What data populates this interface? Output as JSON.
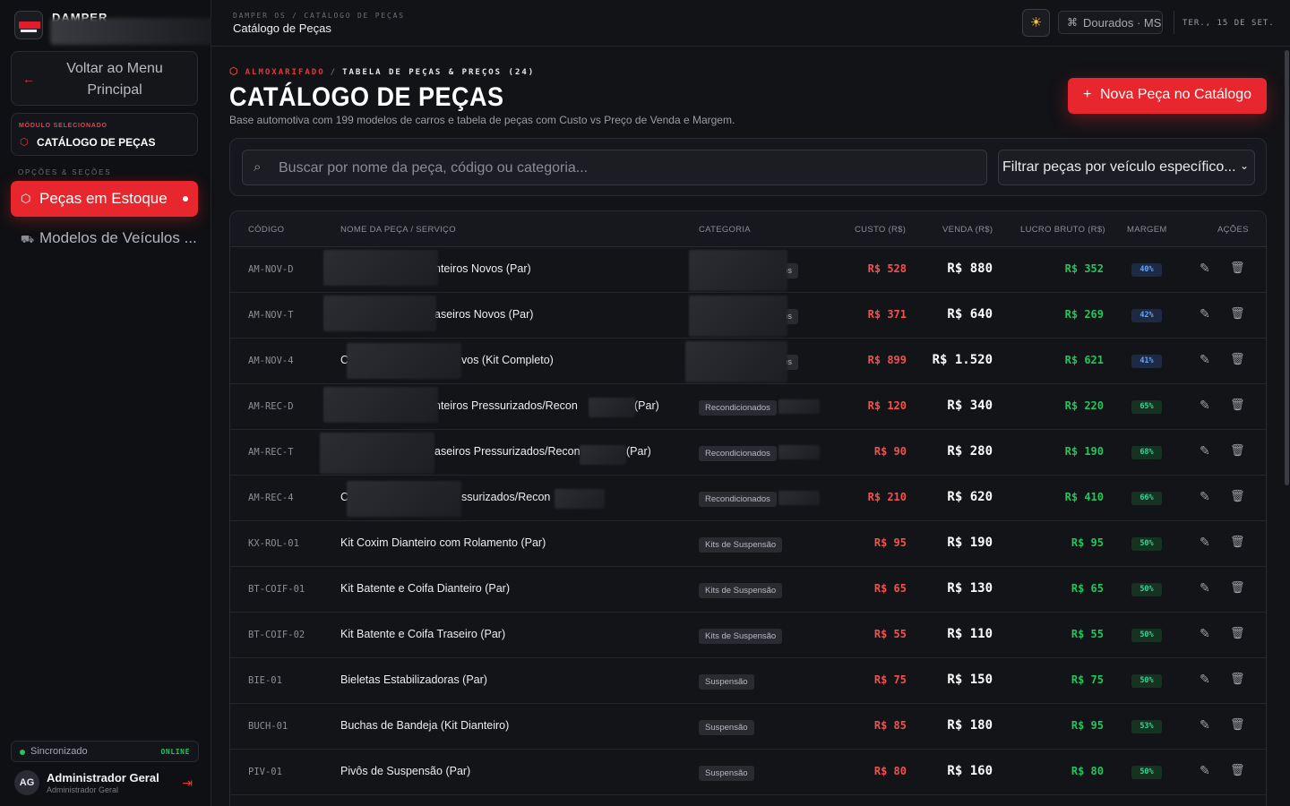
{
  "sidebar": {
    "brand": "DAMPER",
    "back_button": "Voltar ao Menu Principal",
    "module_kicker": "MÓDULO SELECIONADO",
    "module_name": "CATÁLOGO DE PEÇAS",
    "section_title": "OPÇÕES & SEÇÕES",
    "nav": [
      {
        "label": "Peças em Estoque",
        "icon": "box-icon",
        "active": true
      },
      {
        "label": "Modelos de Veículos ...",
        "icon": "car-icon",
        "active": false
      }
    ],
    "sync_label": "Sincronizado",
    "sync_status": "ONLINE",
    "user": {
      "initials": "AG",
      "name": "Administrador Geral",
      "role": "Administrador Geral"
    }
  },
  "topbar": {
    "breadcrumb": "DAMPER OS / CATÁLOGO DE PEÇAS",
    "title": "Catálogo de Peças",
    "city": "Dourados · MS",
    "date": "TER., 15 DE SET."
  },
  "header": {
    "kicker_section": "ALMOXARIFADO",
    "kicker_page": "TABELA DE PEÇAS & PREÇOS (24)",
    "title": "CATÁLOGO DE PEÇAS",
    "subtitle": "Base automotiva com 199 modelos de carros e tabela de peças com Custo vs Preço de Venda e Margem.",
    "new_button": "Nova Peça no Catálogo"
  },
  "filters": {
    "search_placeholder": "Buscar por nome da peça, código ou categoria...",
    "vehicle_filter": "Filtrar peças por veículo específico..."
  },
  "table": {
    "columns": [
      "CÓDIGO",
      "NOME DA PEÇA / SERVIÇO",
      "CATEGORIA",
      "CUSTO (R$)",
      "VENDA (R$)",
      "LUCRO BRUTO (R$)",
      "MARGEM",
      "AÇÕES"
    ],
    "rows": [
      {
        "code": "AM-NOV-D",
        "name": "nteiros Novos (Par)",
        "category": "os",
        "cost": "R$ 528",
        "sale": "R$ 880",
        "profit": "R$ 352",
        "margin": "40%",
        "margin_color": "blue"
      },
      {
        "code": "AM-NOV-T",
        "name": "aseiros Novos (Par)",
        "category": "os",
        "cost": "R$ 371",
        "sale": "R$ 640",
        "profit": "R$ 269",
        "margin": "42%",
        "margin_color": "blue"
      },
      {
        "code": "AM-NOV-4",
        "name": "vos (Kit Completo)",
        "category": "os",
        "cost": "R$ 899",
        "sale": "R$ 1.520",
        "profit": "R$ 621",
        "margin": "41%",
        "margin_color": "blue"
      },
      {
        "code": "AM-REC-D",
        "name": "nteiros Pressurizados/Recon",
        "name_tail": "(Par)",
        "category": "Recondicionados",
        "cost": "R$ 120",
        "sale": "R$ 340",
        "profit": "R$ 220",
        "margin": "65%",
        "margin_color": "green"
      },
      {
        "code": "AM-REC-T",
        "name": "aseiros Pressurizados/Recon",
        "name_tail": "(Par)",
        "category": "Recondicionados",
        "cost": "R$ 90",
        "sale": "R$ 280",
        "profit": "R$ 190",
        "margin": "68%",
        "margin_color": "green"
      },
      {
        "code": "AM-REC-4",
        "name": "ssurizados/Recon",
        "category": "Recondicionados",
        "cost": "R$ 210",
        "sale": "R$ 620",
        "profit": "R$ 410",
        "margin": "66%",
        "margin_color": "green"
      },
      {
        "code": "KX-ROL-01",
        "name": "Kit Coxim Dianteiro com Rolamento (Par)",
        "category": "Kits de Suspensão",
        "cost": "R$ 95",
        "sale": "R$ 190",
        "profit": "R$ 95",
        "margin": "50%",
        "margin_color": "green"
      },
      {
        "code": "BT-COIF-01",
        "name": "Kit Batente e Coifa Dianteiro (Par)",
        "category": "Kits de Suspensão",
        "cost": "R$ 65",
        "sale": "R$ 130",
        "profit": "R$ 65",
        "margin": "50%",
        "margin_color": "green"
      },
      {
        "code": "BT-COIF-02",
        "name": "Kit Batente e Coifa Traseiro (Par)",
        "category": "Kits de Suspensão",
        "cost": "R$ 55",
        "sale": "R$ 110",
        "profit": "R$ 55",
        "margin": "50%",
        "margin_color": "green"
      },
      {
        "code": "BIE-01",
        "name": "Bieletas Estabilizadoras (Par)",
        "category": "Suspensão",
        "cost": "R$ 75",
        "sale": "R$ 150",
        "profit": "R$ 75",
        "margin": "50%",
        "margin_color": "green"
      },
      {
        "code": "BUCH-01",
        "name": "Buchas de Bandeja (Kit Dianteiro)",
        "category": "Suspensão",
        "cost": "R$ 85",
        "sale": "R$ 180",
        "profit": "R$ 95",
        "margin": "53%",
        "margin_color": "green"
      },
      {
        "code": "PIV-01",
        "name": "Pivôs de Suspensão (Par)",
        "category": "Suspensão",
        "cost": "R$ 80",
        "sale": "R$ 160",
        "profit": "R$ 80",
        "margin": "50%",
        "margin_color": "green"
      }
    ]
  },
  "colors": {
    "accent": "#e8262d",
    "cost": "#f05252",
    "profit": "#22c55e",
    "margin_blue": "#60a5fa",
    "margin_green": "#34d399"
  }
}
